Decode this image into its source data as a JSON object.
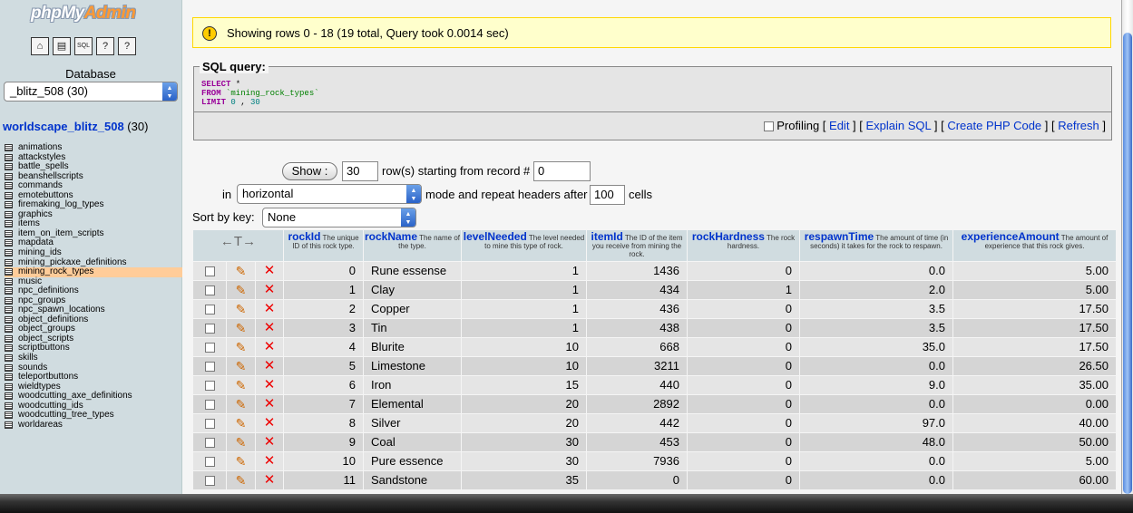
{
  "sidebar": {
    "logo_main": "phpMy",
    "logo_accent": "Admin",
    "nav_icons": [
      {
        "name": "home-icon",
        "glyph": "⌂"
      },
      {
        "name": "query-window-icon",
        "glyph": "▤"
      },
      {
        "name": "sql-icon",
        "glyph": "SQL"
      },
      {
        "name": "docs-icon",
        "glyph": "?"
      },
      {
        "name": "mysql-docs-icon",
        "glyph": "?"
      }
    ],
    "db_label": "Database",
    "db_select": "_blitz_508 (30)",
    "db_name": "worldscape_blitz_508",
    "db_count": "(30)",
    "tables": [
      "animations",
      "attackstyles",
      "battle_spells",
      "beanshellscripts",
      "commands",
      "emotebuttons",
      "firemaking_log_types",
      "graphics",
      "items",
      "item_on_item_scripts",
      "mapdata",
      "mining_ids",
      "mining_pickaxe_definitions",
      "mining_rock_types",
      "music",
      "npc_definitions",
      "npc_groups",
      "npc_spawn_locations",
      "object_definitions",
      "object_groups",
      "object_scripts",
      "scriptbuttons",
      "skills",
      "sounds",
      "teleportbuttons",
      "wieldtypes",
      "woodcutting_axe_definitions",
      "woodcutting_ids",
      "woodcutting_tree_types",
      "worldareas"
    ],
    "selected_table": "mining_rock_types"
  },
  "notice": {
    "text": "Showing rows 0 - 18 (19 total, Query took 0.0014 sec)"
  },
  "sql": {
    "legend": "SQL query:",
    "select_kw": "SELECT",
    "select_rest": " *",
    "from_kw": "FROM",
    "from_table": " `mining_rock_types`",
    "limit_kw": "LIMIT",
    "limit_a": " 0",
    "limit_sep": " , ",
    "limit_b": "30",
    "profiling": "Profiling",
    "links": [
      "Edit",
      "Explain SQL",
      "Create PHP Code",
      "Refresh"
    ]
  },
  "nav": {
    "show_label": "Show :",
    "rows_value": "30",
    "rows_text": "row(s) starting from record #",
    "start_value": "0",
    "in_text": "in",
    "mode_value": "horizontal",
    "mode_text": "mode and repeat headers after",
    "repeat_value": "100",
    "cells_text": "cells",
    "sort_label": "Sort by key:",
    "sort_value": "None"
  },
  "table": {
    "arrows": "←T→",
    "columns": [
      {
        "name": "rockId",
        "comment": "The unique ID of this rock type."
      },
      {
        "name": "rockName",
        "comment": "The name of the type."
      },
      {
        "name": "levelNeeded",
        "comment": "The level needed to mine this type of rock."
      },
      {
        "name": "itemId",
        "comment": "The ID of the item you receive from mining the rock."
      },
      {
        "name": "rockHardness",
        "comment": "The rock hardness."
      },
      {
        "name": "respawnTime",
        "comment": "The amount of time (in seconds) it takes for the rock to respawn."
      },
      {
        "name": "experienceAmount",
        "comment": "The amount of experience that this rock gives."
      }
    ],
    "rows": [
      [
        "0",
        "Rune essense",
        "1",
        "1436",
        "0",
        "0.0",
        "5.00"
      ],
      [
        "1",
        "Clay",
        "1",
        "434",
        "1",
        "2.0",
        "5.00"
      ],
      [
        "2",
        "Copper",
        "1",
        "436",
        "0",
        "3.5",
        "17.50"
      ],
      [
        "3",
        "Tin",
        "1",
        "438",
        "0",
        "3.5",
        "17.50"
      ],
      [
        "4",
        "Blurite",
        "10",
        "668",
        "0",
        "35.0",
        "17.50"
      ],
      [
        "5",
        "Limestone",
        "10",
        "3211",
        "0",
        "0.0",
        "26.50"
      ],
      [
        "6",
        "Iron",
        "15",
        "440",
        "0",
        "9.0",
        "35.00"
      ],
      [
        "7",
        "Elemental",
        "20",
        "2892",
        "0",
        "0.0",
        "0.00"
      ],
      [
        "8",
        "Silver",
        "20",
        "442",
        "0",
        "97.0",
        "40.00"
      ],
      [
        "9",
        "Coal",
        "30",
        "453",
        "0",
        "48.0",
        "50.00"
      ],
      [
        "10",
        "Pure essence",
        "30",
        "7936",
        "0",
        "0.0",
        "5.00"
      ],
      [
        "11",
        "Sandstone",
        "35",
        "0",
        "0",
        "0.0",
        "60.00"
      ]
    ]
  },
  "colors": {
    "row_odd": "#e5e5e5",
    "row_even": "#d5d5d5",
    "header": "#d0dce0",
    "link": "#0033cc",
    "selected_table": "#ffcc99"
  }
}
